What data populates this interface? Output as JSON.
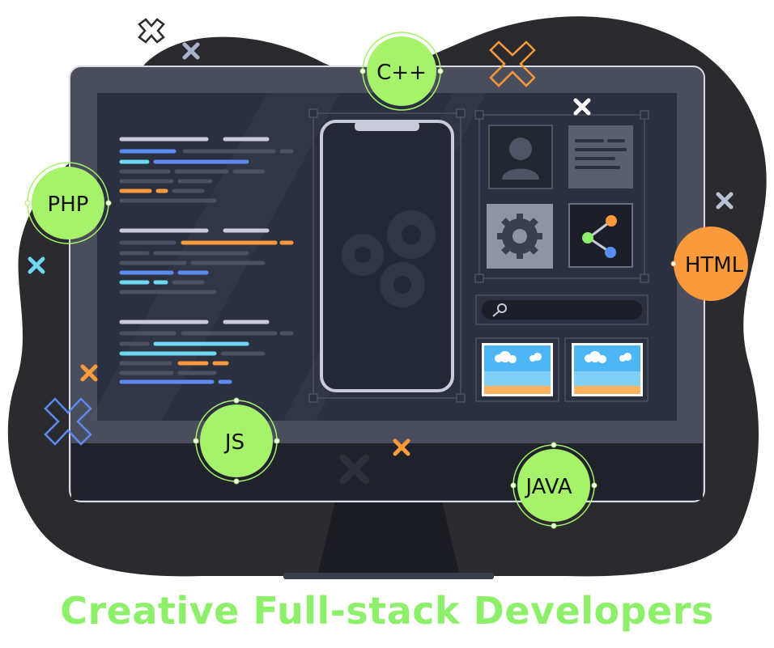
{
  "badges": {
    "cpp": "C++",
    "php": "PHP",
    "html": "HTML",
    "js": "JS",
    "java": "JAVA"
  },
  "tagline": "Creative Full-stack Developers",
  "colors": {
    "blob": "#2b2a2f",
    "monitor_frame": "#4a4d5c",
    "screen": "#2b3040",
    "green_badge": "#a6f26a",
    "orange_badge": "#fb9a3c",
    "tagline": "#8ef06a",
    "code_blue": "#5b8bf0",
    "code_cyan": "#6fd7f2",
    "code_orange": "#fb9a3c",
    "code_gray": "#4b5162"
  },
  "icons": [
    "user-avatar-icon",
    "gear-icon",
    "share-icon",
    "search-icon",
    "landscape-image-icon",
    "cross-mark-icon"
  ]
}
